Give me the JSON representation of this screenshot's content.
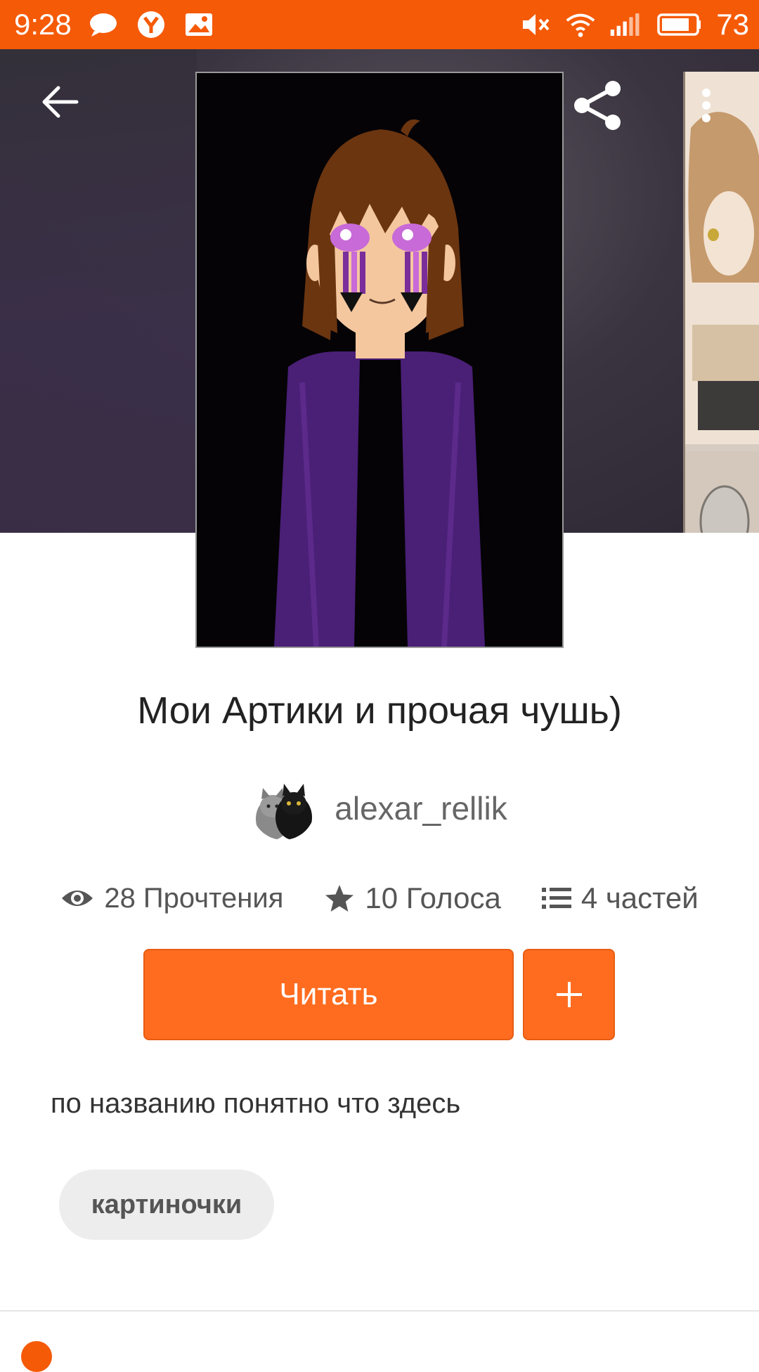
{
  "status_bar": {
    "time": "9:28",
    "battery": "73",
    "color": "#f55a07"
  },
  "header": {
    "back_icon": "arrow-left-icon",
    "share_icon": "share-icon",
    "more_icon": "more-vertical-icon"
  },
  "story": {
    "title": "Мои Артики и прочая чушь)",
    "author": "alexar_rellik",
    "stats": {
      "reads": "28 Прочтения",
      "votes": "10 Голоса",
      "parts": "4 частей"
    },
    "read_label": "Читать",
    "add_label": "+",
    "description": "по названию понятно что здесь",
    "tags": [
      "картиночки"
    ]
  },
  "accent_color": "#ff6c1f"
}
